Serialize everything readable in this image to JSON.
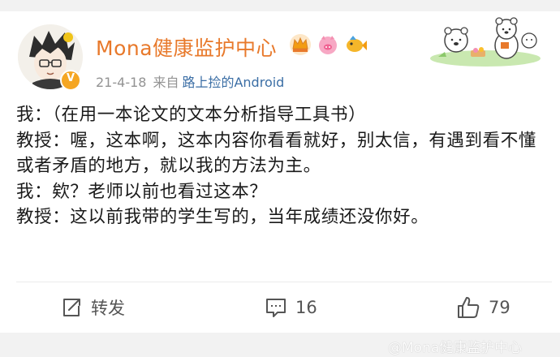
{
  "user": {
    "name": "Mona健康监护中心",
    "verified_mark": "V",
    "badges": [
      "crown-badge-icon",
      "pig-badge-icon",
      "fish-badge-icon"
    ]
  },
  "meta": {
    "date": "21-4-18",
    "source_label": "来自",
    "device": "路上捡的Android"
  },
  "post": {
    "lines": [
      "我：（在用一本论文的文本分析指导工具书）",
      "教授：喔，这本啊，这本内容你看看就好，别太信，有遇到看不懂或者矛盾的地方，就以我的方法为主。",
      "我：欸？老师以前也看过这本？",
      "教授：这以前我带的学生写的，当年成绩还没你好。"
    ]
  },
  "actions": {
    "repost_label": "转发",
    "comment_count": "16",
    "like_count": "79"
  },
  "watermark": "@Mona健康监护中心",
  "colors": {
    "username": "#e8792b",
    "device_link": "#3b6ea5",
    "meta_gray": "#939393",
    "verified": "#f5a623"
  }
}
